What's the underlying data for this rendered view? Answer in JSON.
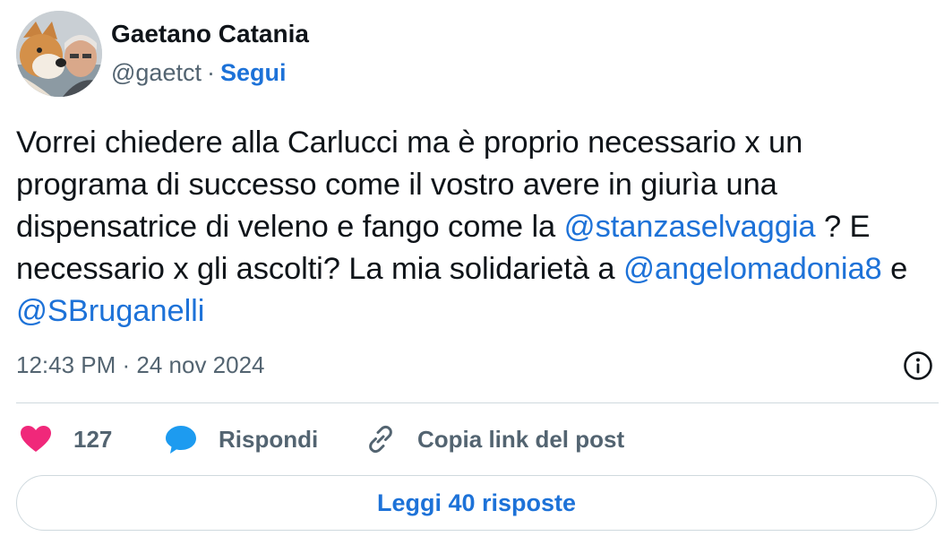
{
  "author": {
    "name": "Gaetano Catania",
    "handle": "@gaetct",
    "separator": "·",
    "follow_label": "Segui",
    "avatar_icon": "avatar-photo"
  },
  "tweet": {
    "segments": [
      {
        "text": "Vorrei chiedere alla Carlucci ma è proprio necessario x un programa di successo come il vostro avere in giurìa una dispensatrice di veleno e fango come la ",
        "mention": false
      },
      {
        "text": "@stanzaselvaggia",
        "mention": true
      },
      {
        "text": " ? E necessario x gli ascolti? La mia solidarietà a ",
        "mention": false
      },
      {
        "text": "@angelomadonia8",
        "mention": true
      },
      {
        "text": " e ",
        "mention": false
      },
      {
        "text": "@SBruganelli",
        "mention": true
      }
    ]
  },
  "meta": {
    "timestamp": "12:43 PM · 24 nov 2024",
    "info_icon": "info-icon"
  },
  "actions": {
    "like_count": "127",
    "reply_label": "Rispondi",
    "copy_label": "Copia link del post"
  },
  "footer": {
    "read_replies_label": "Leggi 40 risposte"
  },
  "colors": {
    "accent": "#1d72d8",
    "like": "#f0287a",
    "reply_icon": "#1d9bf0",
    "muted": "#536471",
    "text": "#0f1419"
  }
}
